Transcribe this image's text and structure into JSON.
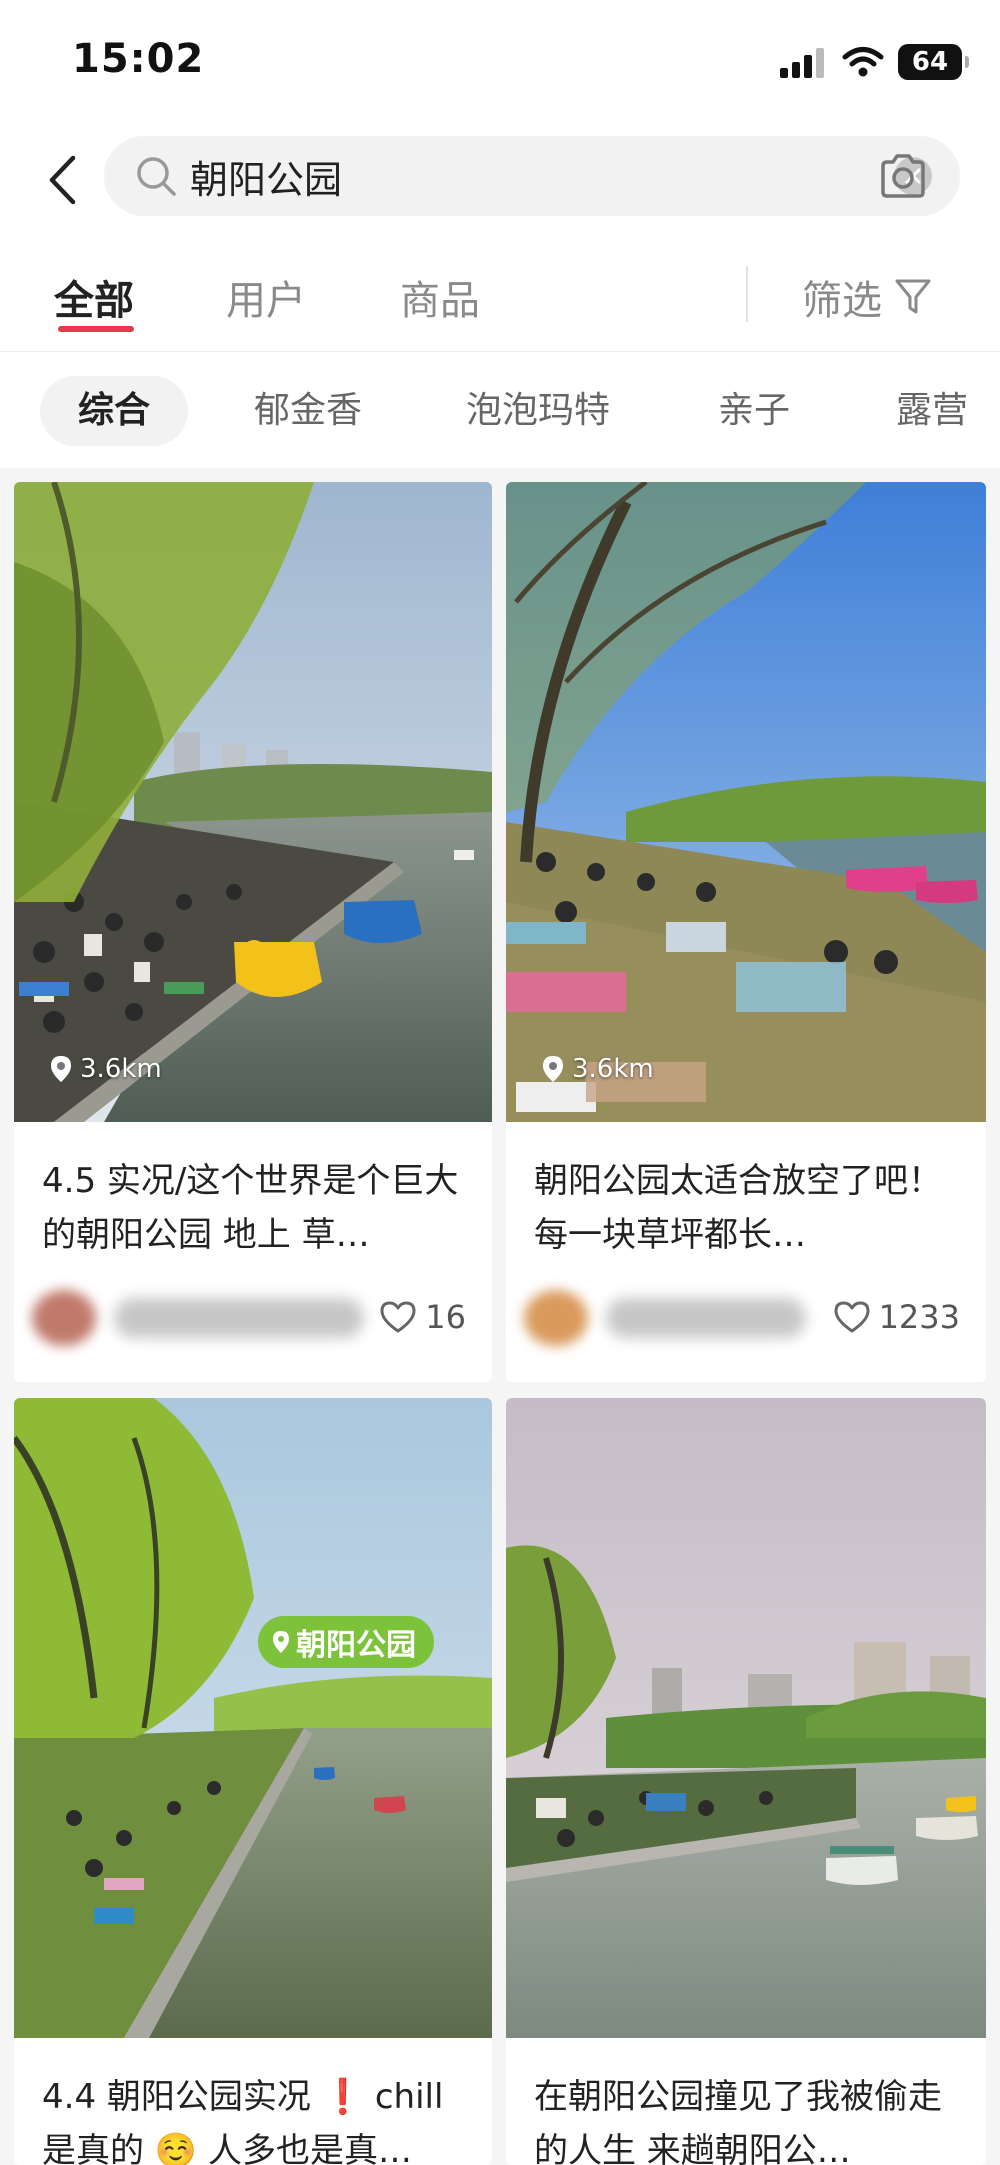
{
  "status_bar": {
    "time": "15:02",
    "battery": "64"
  },
  "search": {
    "query": "朝阳公园",
    "placeholder": ""
  },
  "tabs": [
    {
      "label": "全部",
      "active": true
    },
    {
      "label": "用户",
      "active": false
    },
    {
      "label": "商品",
      "active": false
    }
  ],
  "filter": {
    "label": "筛选"
  },
  "chips": [
    {
      "label": "综合",
      "active": true
    },
    {
      "label": "郁金香",
      "active": false
    },
    {
      "label": "泡泡玛特",
      "active": false
    },
    {
      "label": "亲子",
      "active": false
    },
    {
      "label": "露营",
      "active": false
    }
  ],
  "cards": [
    {
      "location": "3.6km",
      "title": "4.5 实况/这个世界是个巨大的朝阳公园 地上 草…",
      "likes": "16"
    },
    {
      "location": "3.6km",
      "title": "朝阳公园太适合放空了吧！ 每一块草坪都长…",
      "likes": "1233"
    },
    {
      "badge": "朝阳公园",
      "title": "4.4 朝阳公园实况 ❗ chill是真的 ☺️ 人多也是真…"
    },
    {
      "title": "在朝阳公园撞见了我被偷走的人生 来趟朝阳公…"
    }
  ],
  "colors": {
    "accent": "#e8384f",
    "badge": "#7cc33b"
  }
}
